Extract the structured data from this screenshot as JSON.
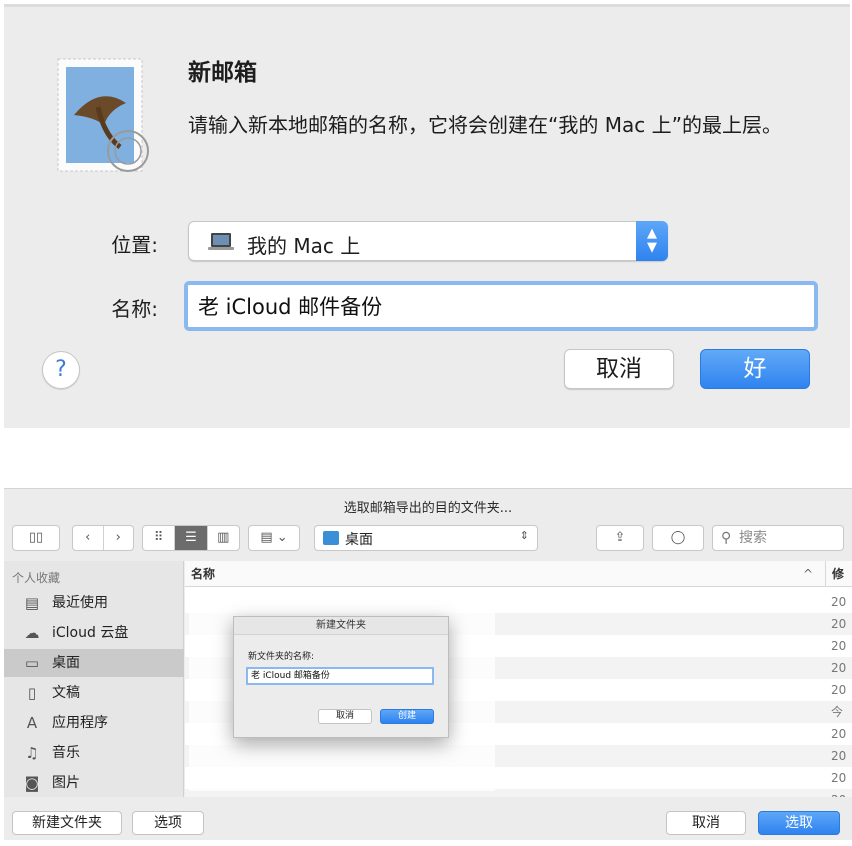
{
  "top_dialog": {
    "title": "新邮箱",
    "message": "请输入新本地邮箱的名称，它将会创建在“我的 Mac 上”的最上层。",
    "location_label": "位置:",
    "location_value": "我的 Mac 上",
    "name_label": "名称:",
    "name_value": "老 iCloud 邮件备份",
    "help_label": "?",
    "cancel_label": "取消",
    "ok_label": "好"
  },
  "export_panel": {
    "title": "选取邮箱导出的目的文件夹...",
    "path_value": "桌面",
    "search_placeholder": "搜索",
    "sidebar_heading": "个人收藏",
    "sidebar_items": [
      {
        "label": "最近使用",
        "icon": "recents-icon"
      },
      {
        "label": "iCloud 云盘",
        "icon": "cloud-icon"
      },
      {
        "label": "桌面",
        "icon": "desktop-icon"
      },
      {
        "label": "文稿",
        "icon": "documents-icon"
      },
      {
        "label": "应用程序",
        "icon": "applications-icon"
      },
      {
        "label": "音乐",
        "icon": "music-icon"
      },
      {
        "label": "图片",
        "icon": "camera-icon"
      }
    ],
    "column_name": "名称",
    "column_modified": "修",
    "rows": [
      "20",
      "20",
      "20",
      "20",
      "20",
      "今",
      "20",
      "20",
      "20",
      "20"
    ],
    "new_folder_button": "新建文件夹",
    "options_button": "选项",
    "cancel_button": "取消",
    "choose_button": "选取"
  },
  "new_folder_dialog": {
    "title": "新建文件夹",
    "label": "新文件夹的名称:",
    "value": "老 iCloud 邮箱备份",
    "cancel_label": "取消",
    "create_label": "创建"
  },
  "colors": {
    "accent": "#2f84f0",
    "focus_ring": "#8ab8f0",
    "dialog_bg": "#ececec"
  }
}
